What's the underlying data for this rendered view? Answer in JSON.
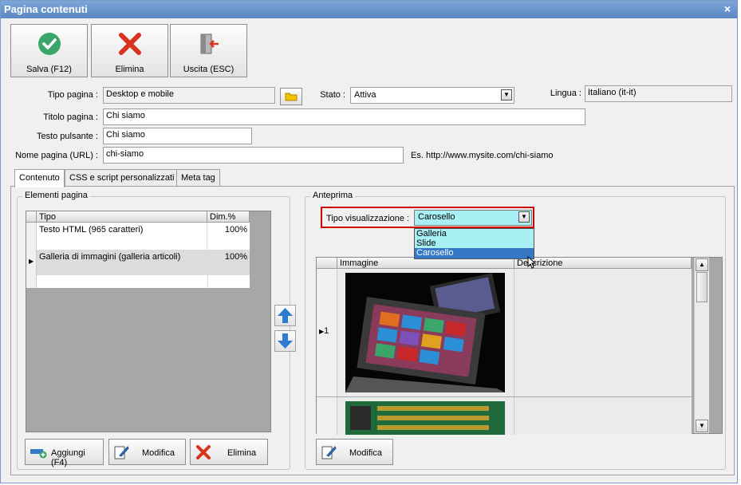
{
  "window": {
    "title": "Pagina contenuti",
    "close": "×"
  },
  "toolbar": {
    "save_label": "Salva (F12)",
    "delete_label": "Elimina",
    "exit_label": "Uscita (ESC)"
  },
  "form": {
    "tipo_label": "Tipo pagina :",
    "tipo_value": "Desktop e mobile",
    "stato_label": "Stato :",
    "stato_value": "Attiva",
    "lingua_label": "Lingua :",
    "lingua_value": "Italiano (it-it)",
    "titolo_label": "Titolo pagina :",
    "titolo_value": "Chi siamo",
    "testo_label": "Testo pulsante :",
    "testo_value": "Chi siamo",
    "nome_label": "Nome pagina (URL) :",
    "nome_value": "chi-siamo",
    "url_hint": "Es. http://www.mysite.com/chi-siamo"
  },
  "tabs": [
    "Contenuto",
    "CSS e script personalizzati",
    "Meta tag"
  ],
  "elementi": {
    "title": "Elementi pagina",
    "col_tipo": "Tipo",
    "col_dim": "Dim.%",
    "rows": [
      {
        "tipo": "Testo HTML (965 caratteri)",
        "dim": "100%"
      },
      {
        "tipo": "Galleria di immagini (galleria articoli)",
        "dim": "100%"
      }
    ],
    "add_label": "Aggiungi (F4)",
    "edit_label": "Modifica",
    "delete_label": "Elimina"
  },
  "anteprima": {
    "title": "Anteprima",
    "tipo_label": "Tipo visualizzazione :",
    "tipo_value": "Carosello",
    "options": [
      "Galleria",
      "Slide",
      "Carosello"
    ],
    "col_immagine": "Immagine",
    "col_descrizione": "Descrizione",
    "row1_index": "1",
    "edit_label": "Modifica"
  },
  "colors": {
    "highlight": "#cc0000",
    "dropdown_bg": "#a8f0f4",
    "selected": "#3478c6"
  }
}
